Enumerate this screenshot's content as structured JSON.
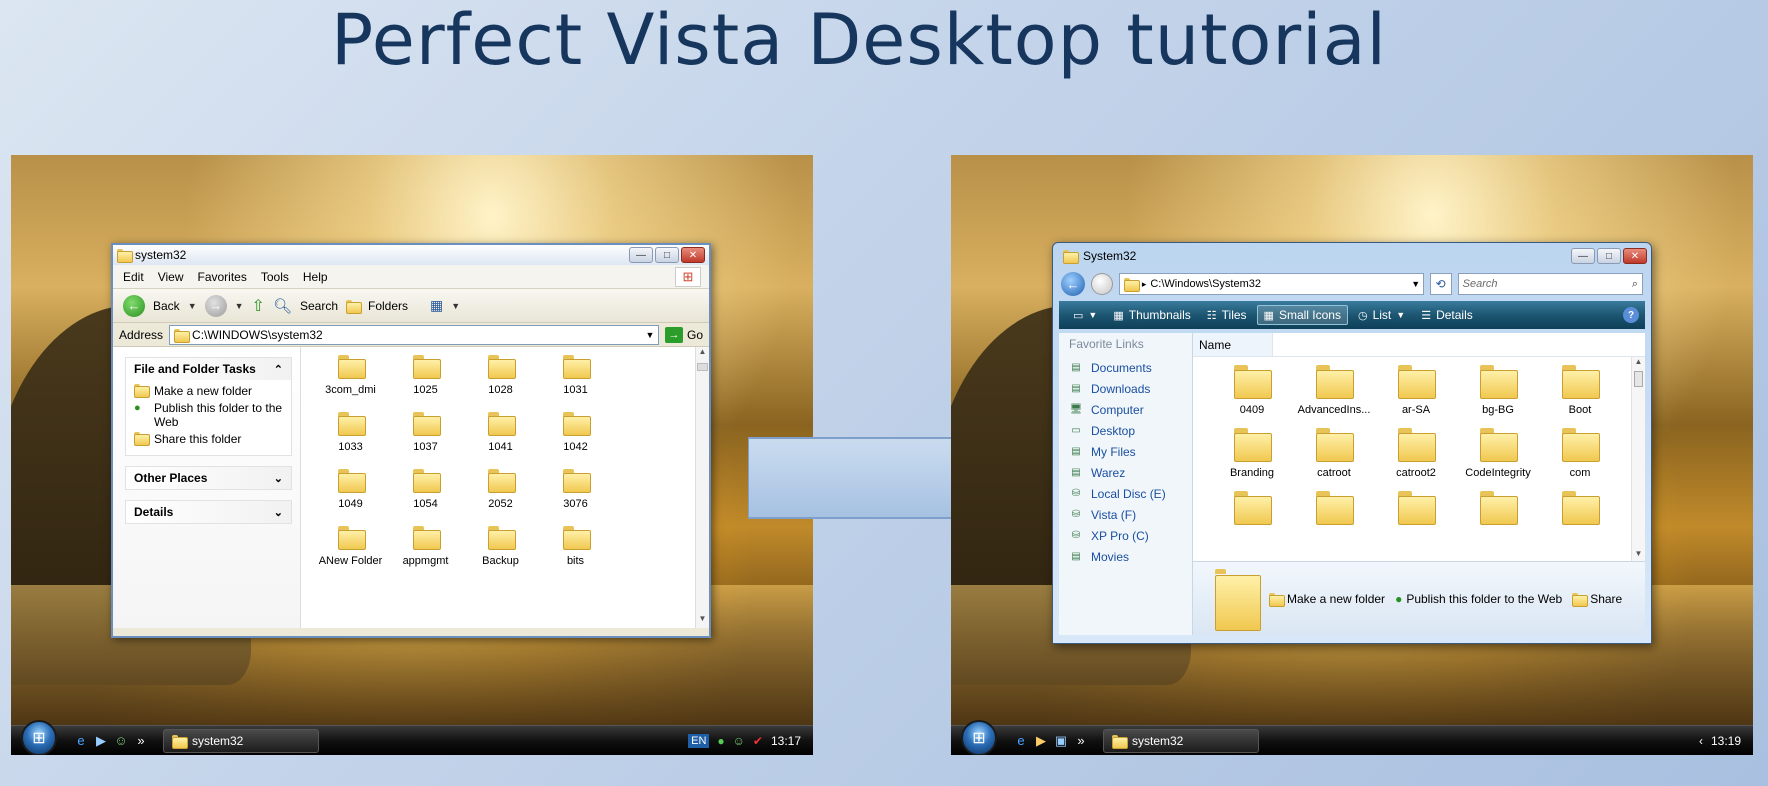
{
  "title": "Perfect Vista Desktop tutorial",
  "xp": {
    "window_title": "system32",
    "menu": [
      "Edit",
      "View",
      "Favorites",
      "Tools",
      "Help"
    ],
    "toolbar": {
      "back": "Back",
      "search": "Search",
      "folders": "Folders"
    },
    "address_label": "Address",
    "address": "C:\\WINDOWS\\system32",
    "go": "Go",
    "tasks": {
      "file_folder_tasks": "File and Folder Tasks",
      "items": [
        "Make a new folder",
        "Publish this folder to the Web",
        "Share this folder"
      ],
      "other_places": "Other Places",
      "details": "Details"
    },
    "files": [
      "3com_dmi",
      "1025",
      "1028",
      "1031",
      "1033",
      "1037",
      "1041",
      "1042",
      "1049",
      "1054",
      "2052",
      "3076",
      "ANew Folder",
      "appmgmt",
      "Backup",
      "bits"
    ],
    "taskbar": {
      "task": "system32",
      "lang": "EN",
      "clock": "13:17"
    }
  },
  "vista": {
    "window_title": "System32",
    "address": "C:\\Windows\\System32",
    "search_placeholder": "Search",
    "commands": [
      "Thumbnails",
      "Tiles",
      "Small Icons",
      "List",
      "Details"
    ],
    "favorites_header": "Favorite Links",
    "favorites": [
      "Documents",
      "Downloads",
      "Computer",
      "Desktop",
      "My Files",
      "Warez",
      "Local Disc (E)",
      "Vista (F)",
      "XP Pro (C)",
      "Movies"
    ],
    "column_name": "Name",
    "files": [
      "0409",
      "AdvancedIns...",
      "ar-SA",
      "bg-BG",
      "Boot",
      "Branding",
      "catroot",
      "catroot2",
      "CodeIntegrity",
      "com",
      "",
      "",
      "",
      "",
      ""
    ],
    "details_tasks": [
      "Make a new folder",
      "Publish this folder to the Web",
      "Share"
    ],
    "taskbar": {
      "task": "system32",
      "clock": "13:19"
    }
  }
}
